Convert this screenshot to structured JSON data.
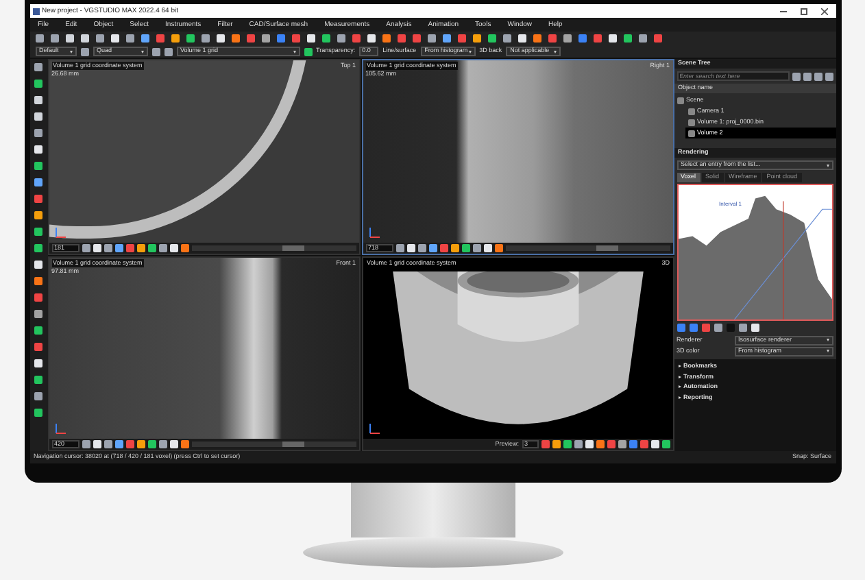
{
  "window": {
    "title": "New project - VGSTUDIO MAX 2022.4 64 bit"
  },
  "menu": [
    "File",
    "Edit",
    "Object",
    "Select",
    "Instruments",
    "Filter",
    "CAD/Surface mesh",
    "Measurements",
    "Analysis",
    "Animation",
    "Tools",
    "Window",
    "Help"
  ],
  "toolbar": {
    "layout": "Default",
    "view": "Quad",
    "grid": "Volume 1 grid",
    "transparency_label": "Transparency:",
    "transparency": "0.0",
    "mode": "Line/surface",
    "source": "From histogram",
    "back_label": "3D back",
    "back_value": "Not applicable"
  },
  "viewports": [
    {
      "kind": "top",
      "title": "Volume 1 grid coordinate system",
      "size": "26.68 mm",
      "view": "Top 1",
      "slice": "181"
    },
    {
      "kind": "right",
      "title": "Volume 1 grid coordinate system",
      "size": "105.62 mm",
      "view": "Right 1",
      "slice": "718"
    },
    {
      "kind": "front",
      "title": "Volume 1 grid coordinate system",
      "size": "97.81 mm",
      "view": "Front 1",
      "slice": "420"
    },
    {
      "kind": "perspective",
      "title": "Volume 1 grid coordinate system",
      "view": "3D",
      "preview_label": "Preview:",
      "preview": "3"
    }
  ],
  "scene_tree": {
    "title": "Scene Tree",
    "placeholder": "Enter search text here",
    "column": "Object name",
    "items": [
      {
        "label": "Scene",
        "selected": false,
        "children": [
          {
            "label": "Camera 1",
            "selected": false
          },
          {
            "label": "Volume 1: proj_0000.bin",
            "selected": false
          },
          {
            "label": "Volume 2",
            "selected": true
          }
        ]
      }
    ]
  },
  "rendering": {
    "title": "Rendering",
    "placeholder": "Select an entry from the list...",
    "tabs": [
      {
        "label": "Voxel",
        "selected": true
      },
      {
        "label": "Solid",
        "selected": false
      },
      {
        "label": "Wireframe",
        "selected": false
      },
      {
        "label": "Point cloud",
        "selected": false
      }
    ],
    "interval": "Interval 1",
    "properties": [
      {
        "label": "Renderer",
        "value": "Isosurface renderer"
      },
      {
        "label": "3D color",
        "value": "From histogram"
      }
    ]
  },
  "sections": [
    "Bookmarks",
    "Transform",
    "Automation",
    "Reporting"
  ],
  "status_bar": {
    "message": "Navigation cursor: 38020 at (718 / 420 / 181 voxel) (press Ctrl to set cursor)",
    "snap": "Snap: Surface"
  }
}
